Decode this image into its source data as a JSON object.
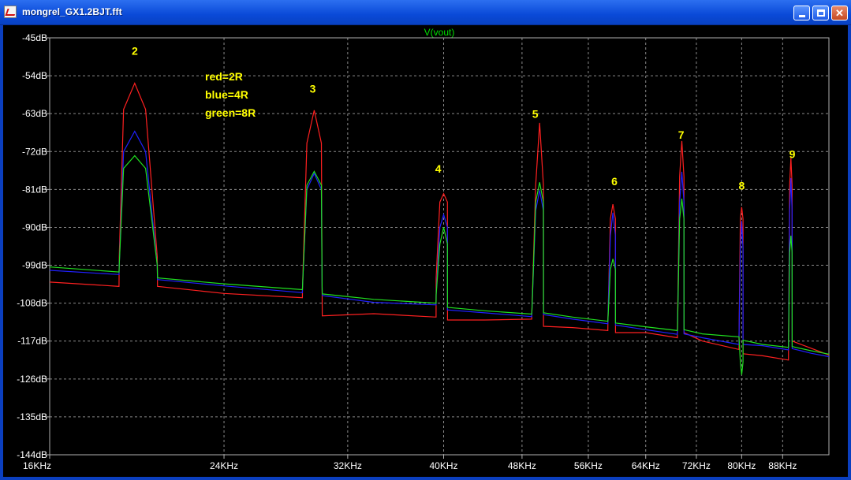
{
  "window": {
    "title": "mongrel_GX1.2BJT.fft",
    "buttons": {
      "minimize": "minimize",
      "maximize": "maximize",
      "close": "close"
    }
  },
  "colors": {
    "background": "#000000",
    "grid": "#8a8a8a",
    "red": "#ff2020",
    "blue": "#2020ff",
    "green": "#20e020",
    "annotation": "#ffff00",
    "trace_title": "#00e000"
  },
  "chart_data": {
    "type": "line",
    "title": "V(vout)",
    "xlabel": "",
    "ylabel": "",
    "x_scale": "log",
    "x_unit": "Hz",
    "xlim": [
      16000,
      98000
    ],
    "ylim": [
      -144,
      -45
    ],
    "grid": true,
    "y_ticks": [
      "-45dB",
      "-54dB",
      "-63dB",
      "-72dB",
      "-81dB",
      "-90dB",
      "-99dB",
      "-108dB",
      "-117dB",
      "-126dB",
      "-135dB",
      "-144dB"
    ],
    "x_ticks": [
      {
        "label": "16KHz",
        "value": 16000
      },
      {
        "label": "24KHz",
        "value": 24000
      },
      {
        "label": "32KHz",
        "value": 32000
      },
      {
        "label": "40KHz",
        "value": 40000
      },
      {
        "label": "48KHz",
        "value": 48000
      },
      {
        "label": "56KHz",
        "value": 56000
      },
      {
        "label": "64KHz",
        "value": 64000
      },
      {
        "label": "72KHz",
        "value": 72000
      },
      {
        "label": "80KHz",
        "value": 80000
      },
      {
        "label": "88KHz",
        "value": 88000
      }
    ],
    "harmonic_labels": [
      {
        "text": "2",
        "x": 19500,
        "y": -49
      },
      {
        "text": "3",
        "x": 29500,
        "y": -58
      },
      {
        "text": "4",
        "x": 39500,
        "y": -77
      },
      {
        "text": "5",
        "x": 49500,
        "y": -64
      },
      {
        "text": "6",
        "x": 59500,
        "y": -80
      },
      {
        "text": "7",
        "x": 69500,
        "y": -69
      },
      {
        "text": "8",
        "x": 80000,
        "y": -81
      },
      {
        "text": "9",
        "x": 90000,
        "y": -73.5
      }
    ],
    "legend_annotations": [
      "red=2R",
      "blue=4R",
      "green=8R"
    ],
    "series": [
      {
        "name": "red",
        "color": "#ff2020",
        "x": [
          16000,
          18800,
          18810,
          19000,
          19500,
          20000,
          20550,
          20560,
          24000,
          28800,
          28810,
          29100,
          29600,
          30100,
          30150,
          30160,
          34000,
          39300,
          39310,
          39650,
          40000,
          40350,
          40360,
          44000,
          49100,
          49110,
          49550,
          50000,
          50450,
          50460,
          54000,
          58600,
          58610,
          58950,
          59300,
          59640,
          59650,
          64000,
          68900,
          68910,
          69250,
          69600,
          69950,
          69960,
          73000,
          79500,
          79510,
          79750,
          80000,
          80250,
          80260,
          84000,
          89200,
          89210,
          89450,
          89700,
          89960,
          89970,
          94000,
          98000
        ],
        "y": [
          -103,
          -104,
          -97,
          -62,
          -55.8,
          -62,
          -97,
          -104,
          -105.7,
          -106.7,
          -104,
          -70,
          -62.2,
          -70,
          -104,
          -111,
          -110.5,
          -111.3,
          -102,
          -84,
          -82,
          -84,
          -112,
          -112,
          -111.8,
          -110,
          -80,
          -65.2,
          -80,
          -113.5,
          -113.8,
          -114.5,
          -112,
          -88,
          -84.5,
          -88,
          -115,
          -115,
          -116.2,
          -113,
          -78,
          -69.5,
          -78,
          -115,
          -117,
          -119,
          -116,
          -88,
          -85.2,
          -88,
          -120,
          -120.5,
          -121.5,
          -118,
          -80,
          -73.5,
          -80,
          -117,
          -118.7,
          -120.3
        ]
      },
      {
        "name": "blue",
        "color": "#2020ff",
        "x": [
          16000,
          18800,
          18810,
          19000,
          19500,
          20000,
          20550,
          20560,
          24000,
          28800,
          28810,
          29100,
          29600,
          30100,
          30150,
          30160,
          34000,
          39300,
          39310,
          39650,
          40000,
          40350,
          40360,
          44000,
          49100,
          49110,
          49550,
          50000,
          50450,
          50460,
          54000,
          58600,
          58610,
          58950,
          59300,
          59640,
          59650,
          64000,
          68900,
          68910,
          69250,
          69600,
          69950,
          69960,
          73000,
          79500,
          79510,
          79750,
          80000,
          80250,
          80260,
          84000,
          89200,
          89210,
          89450,
          89700,
          89960,
          89970,
          94000,
          98000
        ],
        "y": [
          -100.2,
          -101.2,
          -99,
          -72,
          -67.2,
          -72,
          -99,
          -102.4,
          -103.9,
          -105.5,
          -104,
          -81,
          -77.2,
          -81,
          -104,
          -106.2,
          -107.8,
          -108.4,
          -106,
          -90,
          -87,
          -90,
          -109.6,
          -110.3,
          -111.2,
          -110,
          -86,
          -81.2,
          -86,
          -110.7,
          -111.8,
          -112.9,
          -112,
          -92,
          -86.5,
          -92,
          -113.2,
          -114.3,
          -115.4,
          -114,
          -84,
          -76.8,
          -84,
          -115.3,
          -116.2,
          -117.8,
          -116,
          -95,
          -88.5,
          -95,
          -117.8,
          -118.1,
          -119.1,
          -118,
          -86,
          -78.3,
          -86,
          -118.8,
          -119.9,
          -120.7
        ]
      },
      {
        "name": "green",
        "color": "#20e020",
        "x": [
          16000,
          18800,
          18810,
          19000,
          19500,
          20000,
          20550,
          20560,
          24000,
          28800,
          28810,
          29100,
          29600,
          30100,
          30150,
          30160,
          34000,
          39300,
          39310,
          39650,
          40000,
          40350,
          40360,
          44000,
          49100,
          49110,
          49550,
          50000,
          50450,
          50460,
          54000,
          58600,
          58610,
          58950,
          59300,
          59640,
          59650,
          64000,
          68900,
          68910,
          69250,
          69600,
          69950,
          69960,
          73000,
          79500,
          79510,
          79750,
          80000,
          80250,
          80260,
          84000,
          89200,
          89210,
          89450,
          89700,
          89960,
          89970,
          94000,
          98000
        ],
        "y": [
          -99.4,
          -100.6,
          -99,
          -76,
          -73,
          -76,
          -99,
          -102,
          -103.4,
          -104.8,
          -104,
          -80,
          -76.7,
          -80,
          -104,
          -105.8,
          -107.1,
          -108,
          -106,
          -94,
          -90,
          -94,
          -109,
          -109.8,
          -110.6,
          -110,
          -84,
          -79.3,
          -84,
          -110.3,
          -111.3,
          -112.3,
          -112,
          -100,
          -97.5,
          -100,
          -112.7,
          -113.6,
          -114.5,
          -114,
          -88,
          -83.2,
          -88,
          -114.3,
          -115.3,
          -116,
          -116,
          -122,
          -125,
          -122,
          -116.8,
          -117.8,
          -118.5,
          -118,
          -96,
          -92,
          -96,
          -118.3,
          -119.3,
          -120.1
        ]
      }
    ]
  }
}
